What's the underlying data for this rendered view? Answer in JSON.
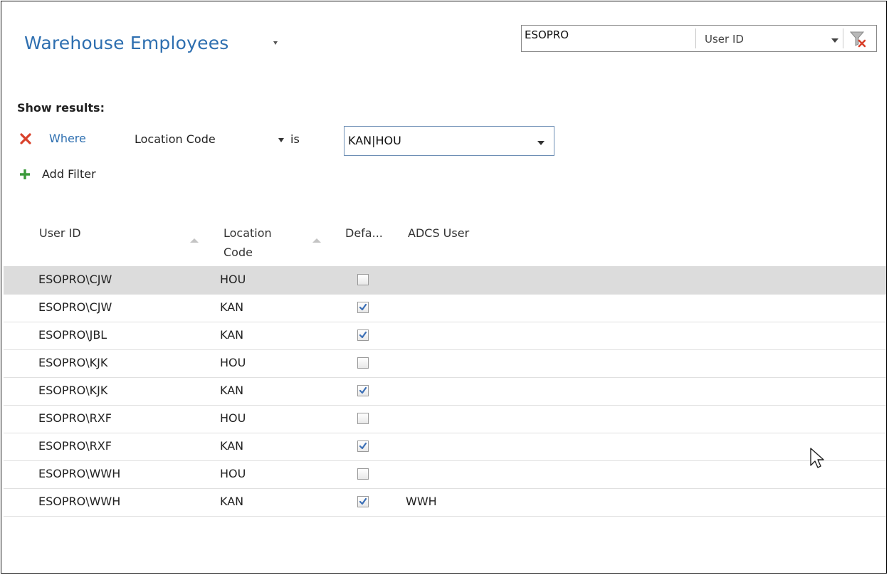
{
  "page": {
    "title": "Warehouse Employees",
    "search": {
      "value": "ESOPRO",
      "field_label": "User ID"
    }
  },
  "filters": {
    "heading": "Show results:",
    "where_label": "Where",
    "field": "Location Code",
    "operator": "is",
    "value": "KAN|HOU",
    "add_filter_label": "Add Filter"
  },
  "columns": [
    {
      "label_line1": "User ID",
      "label_line2": ""
    },
    {
      "label_line1": "Location",
      "label_line2": "Code"
    },
    {
      "label_line1": "Defa...",
      "label_line2": ""
    },
    {
      "label_line1": "ADCS User",
      "label_line2": ""
    }
  ],
  "rows": [
    {
      "user_id": "ESOPRO\\CJW",
      "location_code": "HOU",
      "default": false,
      "adcs_user": "",
      "selected": true
    },
    {
      "user_id": "ESOPRO\\CJW",
      "location_code": "KAN",
      "default": true,
      "adcs_user": ""
    },
    {
      "user_id": "ESOPRO\\JBL",
      "location_code": "KAN",
      "default": true,
      "adcs_user": ""
    },
    {
      "user_id": "ESOPRO\\KJK",
      "location_code": "HOU",
      "default": false,
      "adcs_user": ""
    },
    {
      "user_id": "ESOPRO\\KJK",
      "location_code": "KAN",
      "default": true,
      "adcs_user": ""
    },
    {
      "user_id": "ESOPRO\\RXF",
      "location_code": "HOU",
      "default": false,
      "adcs_user": ""
    },
    {
      "user_id": "ESOPRO\\RXF",
      "location_code": "KAN",
      "default": true,
      "adcs_user": ""
    },
    {
      "user_id": "ESOPRO\\WWH",
      "location_code": "HOU",
      "default": false,
      "adcs_user": ""
    },
    {
      "user_id": "ESOPRO\\WWH",
      "location_code": "KAN",
      "default": true,
      "adcs_user": "WWH"
    }
  ],
  "colors": {
    "title": "#2e6fb0",
    "link": "#2e6fb0",
    "remove_icon": "#d9412b",
    "add_icon": "#3a9a3a",
    "selected_row": "#dcdcdc",
    "checkmark": "#3b6fb6"
  },
  "icons": {
    "title_menu": "chevron-down-icon",
    "clear_filter": "filter-clear-icon",
    "remove_filter": "close-icon",
    "add_filter": "plus-icon",
    "sort": "sort-ascending-icon",
    "cursor": "mouse-pointer-icon"
  }
}
